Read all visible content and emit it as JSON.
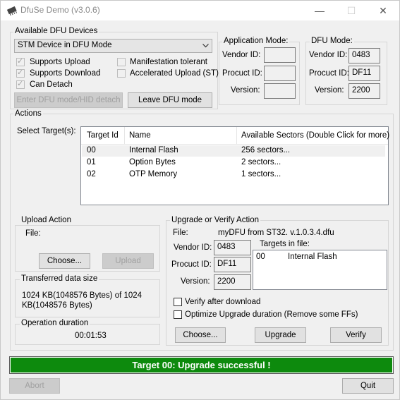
{
  "window": {
    "title": "DfuSe Demo (v3.0.6)",
    "icon": "dfuse-chip-icon",
    "minimize": "—",
    "maximize": "☐",
    "close": "✕"
  },
  "devices": {
    "label": "Available DFU Devices",
    "selected": "STM Device in DFU Mode",
    "supports_upload": "Supports Upload",
    "supports_download": "Supports Download",
    "can_detach": "Can Detach",
    "manifestation_tolerant": "Manifestation tolerant",
    "accelerated_upload": "Accelerated Upload (ST)",
    "enter_dfu": "Enter DFU mode/HID detach",
    "leave_dfu": "Leave DFU mode"
  },
  "app_mode": {
    "label": "Application Mode:",
    "vendor_label": "Vendor ID:",
    "product_label": "Procuct ID:",
    "version_label": "Version:",
    "vendor": "",
    "product": "",
    "version": ""
  },
  "dfu_mode": {
    "label": "DFU Mode:",
    "vendor_label": "Vendor ID:",
    "product_label": "Procuct ID:",
    "version_label": "Version:",
    "vendor": "0483",
    "product": "DF11",
    "version": "2200"
  },
  "actions": {
    "label": "Actions",
    "select_targets": "Select Target(s):",
    "columns": [
      "Target Id",
      "Name",
      "Available Sectors (Double Click for more)"
    ],
    "rows": [
      [
        "00",
        "Internal Flash",
        "256 sectors..."
      ],
      [
        "01",
        "Option Bytes",
        "2 sectors..."
      ],
      [
        "02",
        "OTP Memory",
        "1 sectors..."
      ]
    ]
  },
  "upload": {
    "label": "Upload Action",
    "file_label": "File:",
    "choose": "Choose...",
    "upload": "Upload"
  },
  "transferred": {
    "label": "Transferred data size",
    "value": "1024 KB(1048576 Bytes) of 1024 KB(1048576 Bytes)"
  },
  "duration": {
    "label": "Operation duration",
    "value": "00:01:53"
  },
  "upgrade": {
    "label": "Upgrade or Verify Action",
    "file_label": "File:",
    "file": "myDFU from ST32. v.1.0.3.4.dfu",
    "vendor_label": "Vendor ID:",
    "product_label": "Procuct ID:",
    "version_label": "Version:",
    "vendor": "0483",
    "product": "DF11",
    "version": "2200",
    "targets_label": "Targets in file:",
    "target_id": "00",
    "target_name": "Internal Flash",
    "verify_after": "Verify after download",
    "optimize": "Optimize Upgrade duration (Remove some FFs)",
    "choose": "Choose...",
    "upgrade": "Upgrade",
    "verify": "Verify"
  },
  "status": {
    "text": "Target 00: Upgrade successful !",
    "color": "#0d8a0d"
  },
  "footer": {
    "abort": "Abort",
    "quit": "Quit"
  }
}
